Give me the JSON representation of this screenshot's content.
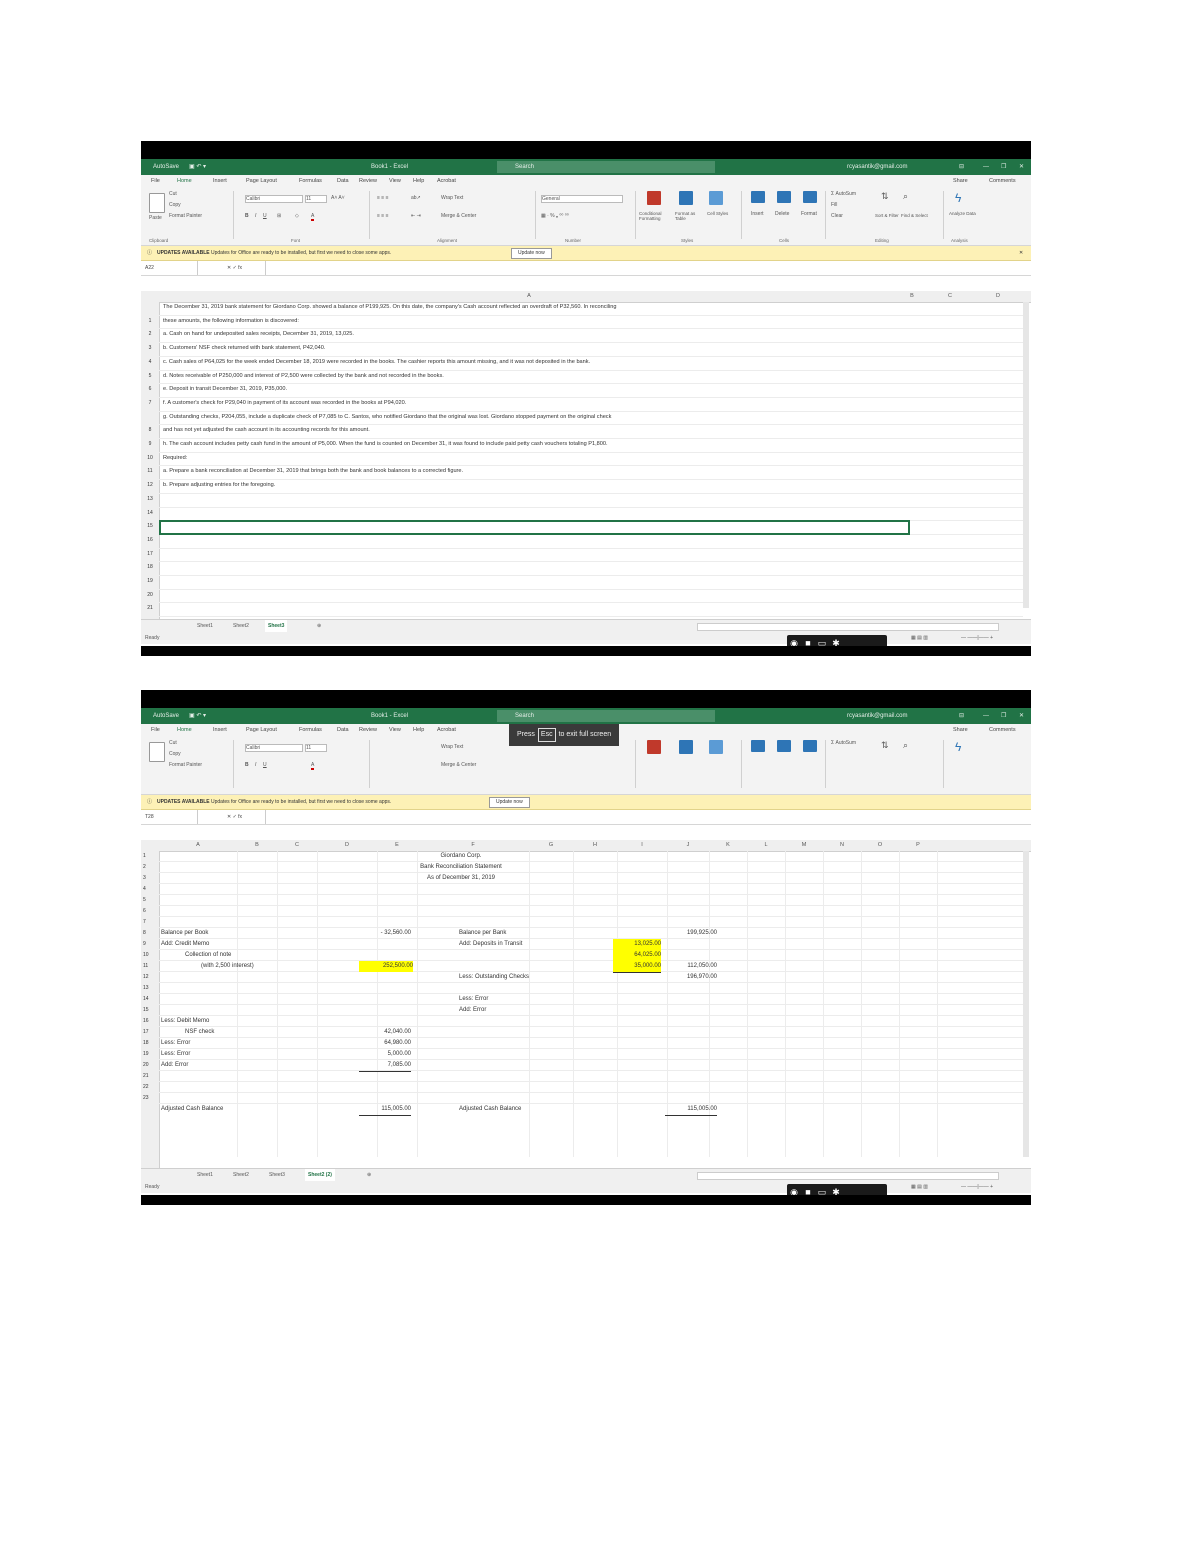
{
  "colors": {
    "excel_green": "#217346",
    "highlight": "#ffff00",
    "notice_bg": "#fdf1b6"
  },
  "shot1": {
    "title": "Book1 - Excel",
    "search_placeholder": "Search",
    "account": "rcyasantik@gmail.com",
    "share": "Share",
    "comments": "Comments",
    "menu_tabs": [
      "File",
      "Home",
      "Insert",
      "Page Layout",
      "Formulas",
      "Data",
      "Review",
      "View",
      "Help",
      "Acrobat"
    ],
    "ribbon": {
      "cut": "Cut",
      "copy": "Copy",
      "format_painter": "Format Painter",
      "paste": "Paste",
      "font_name": "Calibri",
      "font_size": "11",
      "wrap_text": "Wrap Text",
      "merge_center": "Merge & Center",
      "number_format": "General",
      "conditional_formatting": "Conditional Formatting",
      "format_as_table": "Format as Table",
      "cell_styles": "Cell Styles",
      "insert": "Insert",
      "delete": "Delete",
      "format": "Format",
      "autosum": "AutoSum",
      "fill": "Fill",
      "clear": "Clear",
      "sort_filter": "Sort & Filter",
      "find_select": "Find & Select",
      "analyze_data": "Analyze Data",
      "groups": [
        "Clipboard",
        "Font",
        "Alignment",
        "Number",
        "Styles",
        "Cells",
        "Editing",
        "Analysis"
      ]
    },
    "notice_label": "UPDATES AVAILABLE",
    "notice_text": "Updates for Office are ready to be installed, but first we need to close some apps.",
    "notice_button": "Update now",
    "name_box": "A22",
    "columns": [
      "A",
      "B",
      "C",
      "D"
    ],
    "rows": [
      {
        "n": "",
        "text": "The December 31, 2019 bank statement for Giordano Corp. showed a balance of P199,925. On this date, the company's Cash account reflected an overdraft of P32,560. In reconciling"
      },
      {
        "n": "1",
        "text": "these amounts, the following information is discovered:"
      },
      {
        "n": "2",
        "text": "a.   Cash on hand for undeposited sales receipts, December 31, 2019, 13,025."
      },
      {
        "n": "3",
        "text": "b.   Customers' NSF check returned with bank statement, P42,040."
      },
      {
        "n": "4",
        "text": "c.   Cash sales of P64,025 for the week ended December 18, 2019 were recorded in the books. The cashier reports this amount missing, and it was not deposited in the bank."
      },
      {
        "n": "5",
        "text": "d.   Notes receivable of P250,000 and interest of P2,500 were collected by the bank and not recorded in the books."
      },
      {
        "n": "6",
        "text": "e.   Deposit in transit December 31, 2019, P35,000."
      },
      {
        "n": "7",
        "text": "f.   A customer's check for P29,040 in payment of its account was recorded in the books at P94,020."
      },
      {
        "n": "",
        "text": "g.   Outstanding checks, P204,055, include a duplicate check of P7,085 to C. Santos, who notified Giordano that the original was lost. Giordano stopped payment on the original check"
      },
      {
        "n": "8",
        "text": "and has not yet adjusted the cash account in its accounting records for this amount."
      },
      {
        "n": "9",
        "text": "h.   The cash account includes petty cash fund in the amount of P5,000. When the fund is counted on December 31, it was found to include paid petty cash vouchers totaling P1,800."
      },
      {
        "n": "10",
        "text": "Required:"
      },
      {
        "n": "11",
        "text": "a.   Prepare a bank reconciliation at December 31, 2019 that brings both the bank and book balances to a corrected figure."
      },
      {
        "n": "12",
        "text": "b.   Prepare adjusting entries for the foregoing."
      },
      {
        "n": "13",
        "text": ""
      },
      {
        "n": "14",
        "text": ""
      },
      {
        "n": "15",
        "text": ""
      },
      {
        "n": "16",
        "text": ""
      },
      {
        "n": "17",
        "text": ""
      },
      {
        "n": "18",
        "text": ""
      },
      {
        "n": "19",
        "text": ""
      },
      {
        "n": "20",
        "text": ""
      },
      {
        "n": "21",
        "text": ""
      }
    ],
    "sheet_tabs": [
      "Sheet1",
      "Sheet2",
      "Sheet3"
    ],
    "active_sheet": "Sheet3",
    "status": "Ready"
  },
  "shot2": {
    "title": "Book1 - Excel",
    "search_placeholder": "Search",
    "account": "rcyasantik@gmail.com",
    "toast": {
      "pre": "Press",
      "key": "Esc",
      "post": "to exit full screen"
    },
    "name_box": "T28",
    "columns": [
      "A",
      "B",
      "C",
      "D",
      "E",
      "F",
      "G",
      "H",
      "I",
      "J",
      "K",
      "L",
      "M",
      "N",
      "O",
      "P"
    ],
    "row_numbers": [
      "1",
      "2",
      "3",
      "4",
      "5",
      "6",
      "7",
      "8",
      "9",
      "10",
      "11",
      "12",
      "13",
      "14",
      "15",
      "16",
      "17",
      "18",
      "19",
      "20",
      "21",
      "22",
      "23"
    ],
    "header": {
      "company": "Giordano Corp.",
      "statement": "Bank Reconciliation Statement",
      "date": "As of December 31, 2019"
    },
    "book": {
      "balance_label": "Balance per Book",
      "balance_value": "32,560.00",
      "add_label": "Add: Credit Memo",
      "collection_label": "Collection of note",
      "interest_label": "(with 2,500 interest)",
      "credit_value": "252,500.00",
      "less_debit_label": "Less: Debit Memo",
      "nsf_label": "NSF check",
      "nsf_value": "42,040.00",
      "less_error1_label": "Less: Error",
      "less_error1_value": "64,980.00",
      "less_error2_label": "Less: Error",
      "less_error2_value": "5,000.00",
      "add_error_label": "Add: Error",
      "add_error_value": "7,085.00",
      "adjusted_label": "Adjusted Cash Balance",
      "adjusted_value": "115,005.00"
    },
    "bank": {
      "balance_label": "Balance per Bank",
      "balance_value": "199,925.00",
      "dit_label": "Add: Deposits in Transit",
      "dit_values": [
        "13,025.00",
        "64,025.00",
        "35,000.00"
      ],
      "dit_total": "112,050.00",
      "subtotal": "196,970.00",
      "oc_label": "Less: Outstanding Checks",
      "less_error_label": "Less: Error",
      "add_error_label": "Add: Error",
      "adjusted_label": "Adjusted Cash Balance",
      "adjusted_value": "115,005.00"
    },
    "sheet_tabs": [
      "Sheet1",
      "Sheet2",
      "Sheet3",
      "Sheet2 (2)"
    ],
    "active_sheet": "Sheet2 (2)",
    "status": "Ready"
  }
}
